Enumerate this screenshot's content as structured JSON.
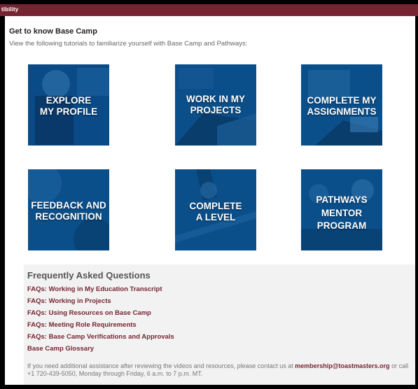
{
  "header": {
    "label": "tibility"
  },
  "intro": {
    "title": "Get to know Base Camp",
    "subtitle": "View the following tutorials to familiarize yourself with Base Camp and Pathways:"
  },
  "tiles": [
    {
      "line1": "EXPLORE",
      "line2": "MY PROFILE"
    },
    {
      "line1": "WORK IN MY",
      "line2": "PROJECTS"
    },
    {
      "line1": "COMPLETE MY",
      "line2": "ASSIGNMENTS"
    },
    {
      "line1": "FEEDBACK AND",
      "line2": "RECOGNITION"
    },
    {
      "line1": "COMPLETE",
      "line2": "A LEVEL"
    },
    {
      "line1": "PATHWAYS",
      "line2": "MENTOR",
      "line3": "PROGRAM"
    }
  ],
  "faq": {
    "title": "Frequently Asked Questions",
    "links": [
      "FAQs: Working in My Education Transcript",
      "FAQs: Working in Projects",
      "FAQs: Using Resources on Base Camp",
      "FAQs: Meeting Role Requirements",
      "FAQs: Base Camp Verifications and Approvals",
      "Base Camp Glossary"
    ],
    "note_prefix": "If you need additional assistance after reviewing the videos and resources, please contact us at ",
    "email": "membership@toastmasters.org",
    "note_suffix": " or call +1 720-439-5050, Monday through Friday, 6 a.m. to 7 p.m. MT."
  },
  "colors": {
    "brand": "#772432",
    "tile": "#0b4f8a"
  }
}
